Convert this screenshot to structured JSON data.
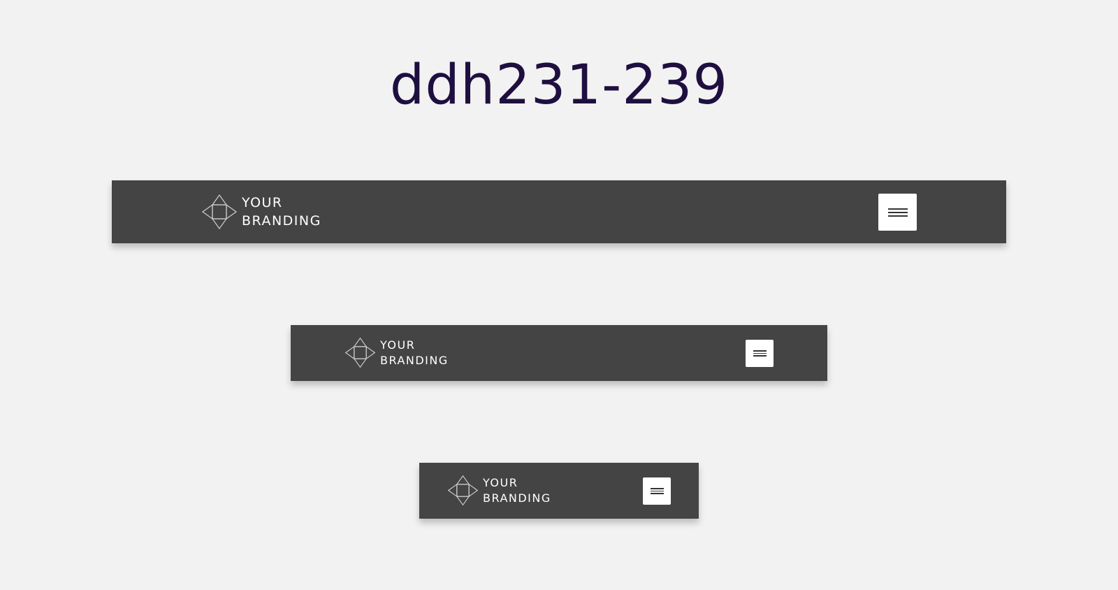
{
  "page": {
    "title": "ddh231-239"
  },
  "navbars": [
    {
      "logo": {
        "line1": "YOUR",
        "line2": "BRANDING",
        "icon": "diamond-logo-icon"
      },
      "menu_icon": "hamburger-menu-icon"
    },
    {
      "logo": {
        "line1": "YOUR",
        "line2": "BRANDING",
        "icon": "diamond-logo-icon"
      },
      "menu_icon": "hamburger-menu-icon"
    },
    {
      "logo": {
        "line1": "YOUR",
        "line2": "BRANDING",
        "icon": "diamond-logo-icon"
      },
      "menu_icon": "hamburger-menu-icon"
    }
  ],
  "colors": {
    "background": "#f2f2f2",
    "title": "#1e0f40",
    "navbar": "#444444",
    "menu_button": "#ffffff",
    "logo_text": "#ffffff"
  }
}
